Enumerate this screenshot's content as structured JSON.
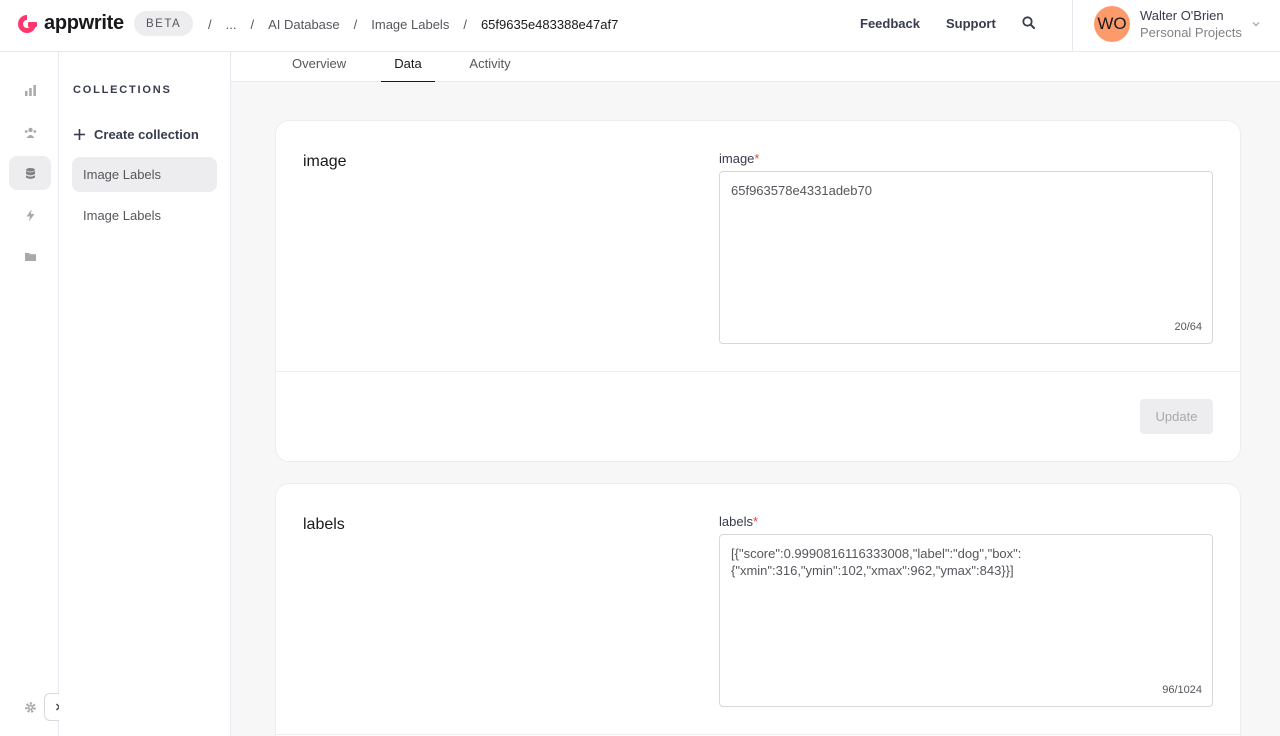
{
  "app": {
    "name": "appwrite",
    "badge": "BETA"
  },
  "breadcrumbs": [
    "...",
    "AI Database",
    "Image Labels",
    "65f9635e483388e47af7"
  ],
  "header": {
    "feedback": "Feedback",
    "support": "Support"
  },
  "user": {
    "initials": "WO",
    "name": "Walter O'Brien",
    "org": "Personal Projects"
  },
  "sidebar": {
    "title": "COLLECTIONS",
    "create_label": "Create collection",
    "items": [
      {
        "label": "Image Labels",
        "active": true
      },
      {
        "label": "Image Labels",
        "active": false
      }
    ]
  },
  "tabs": [
    {
      "label": "Overview",
      "active": false
    },
    {
      "label": "Data",
      "active": true
    },
    {
      "label": "Activity",
      "active": false
    }
  ],
  "attributes": [
    {
      "name": "image",
      "field_label": "image",
      "required_mark": "*",
      "value": "65f963578e4331adeb70",
      "counter": "20/64",
      "update_label": "Update"
    },
    {
      "name": "labels",
      "field_label": "labels",
      "required_mark": "*",
      "value": "[{\"score\":0.9990816116333008,\"label\":\"dog\",\"box\":{\"xmin\":316,\"ymin\":102,\"xmax\":962,\"ymax\":843}}]",
      "counter": "96/1024"
    }
  ],
  "colors": {
    "brand": "#fd366e",
    "avatar": "#fd9a6b",
    "required": "#e0493b"
  }
}
